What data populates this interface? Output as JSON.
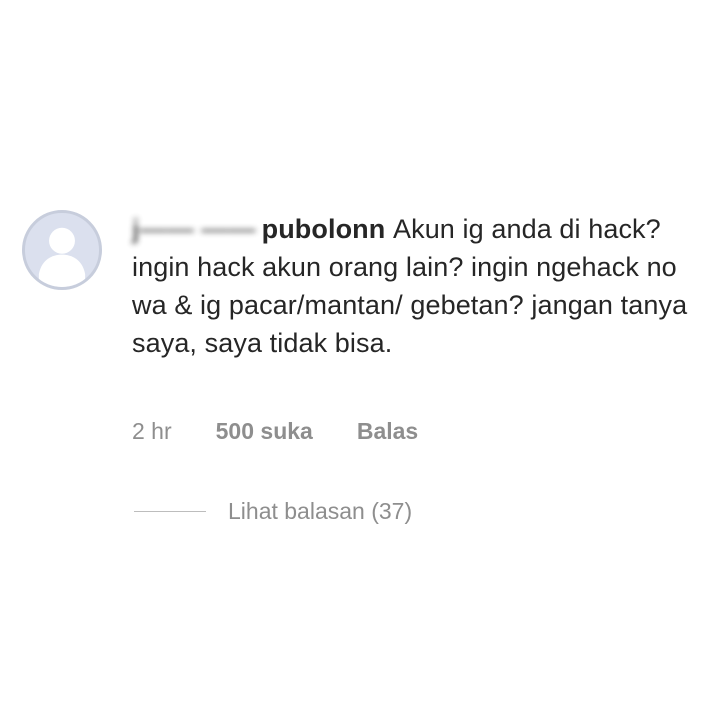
{
  "comment": {
    "username_masked_part": "j—— ——",
    "username_visible_part": "pubolonn",
    "text": " Akun ig anda di hack? ingin hack akun orang lain? ingin ngehack no wa & ig pacar/mantan/ gebetan? jangan tanya saya, saya tidak bisa.",
    "time": "2 hr",
    "likes": "500 suka",
    "reply_label": "Balas",
    "view_replies": "Lihat balasan (37)"
  },
  "avatar": {
    "icon": "default-user-avatar-icon",
    "background": "#dbe0ee",
    "figure": "#ffffff"
  },
  "colors": {
    "text": "#262626",
    "muted": "#8e8e8e",
    "line": "#bdbdbd"
  }
}
